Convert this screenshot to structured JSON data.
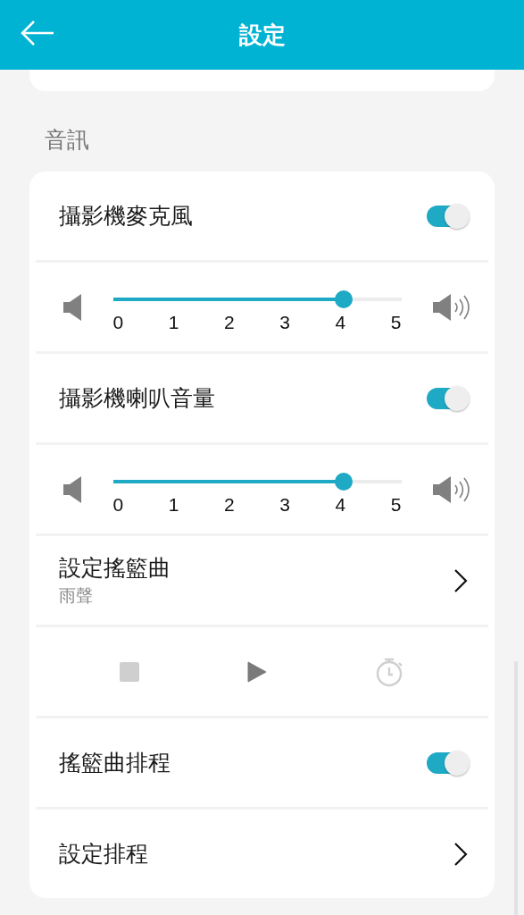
{
  "header": {
    "title": "設定"
  },
  "section": {
    "label": "音訊"
  },
  "rows": [
    {
      "kind": "toggle",
      "label": "攝影機麥克風",
      "on": true
    },
    {
      "kind": "slider",
      "level": 0.8,
      "ticks": [
        "0",
        "1",
        "2",
        "3",
        "4",
        "5"
      ]
    },
    {
      "kind": "toggle",
      "label": "攝影機喇叭音量",
      "on": true
    },
    {
      "kind": "slider",
      "level": 0.8,
      "ticks": [
        "0",
        "1",
        "2",
        "3",
        "4",
        "5"
      ]
    },
    {
      "kind": "nav",
      "label": "設定搖籃曲",
      "value": "雨聲"
    },
    {
      "kind": "player",
      "controls": [
        {
          "kind": "stop",
          "disabled": true
        },
        {
          "kind": "play",
          "disabled": false
        },
        {
          "kind": "timer",
          "disabled": true
        }
      ]
    },
    {
      "kind": "toggle",
      "label": "搖籃曲排程",
      "on": true
    },
    {
      "kind": "nav",
      "label": "設定排程"
    }
  ]
}
